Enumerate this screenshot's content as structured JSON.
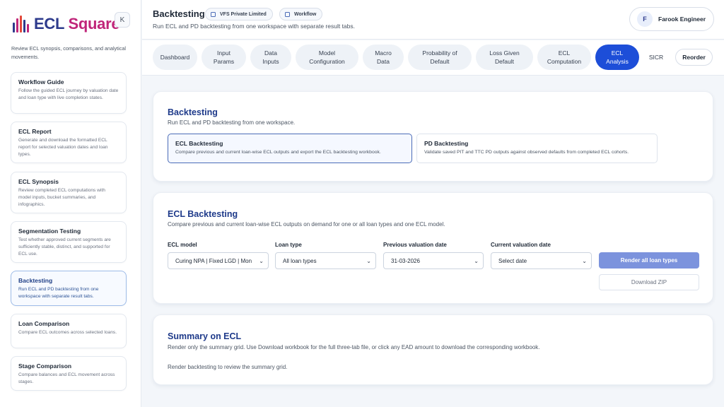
{
  "app": {
    "logo_ecl": "ECL",
    "logo_square": "Square",
    "collapse_label": "K",
    "description": "Review ECL synopsis, comparisons, and analytical movements."
  },
  "sidebar": {
    "items": [
      {
        "title": "Workflow Guide",
        "desc": "Follow the guided ECL journey by valuation date and loan type with live completion states."
      },
      {
        "title": "ECL Report",
        "desc": "Generate and download the formatted ECL report for selected valuation dates and loan types."
      },
      {
        "title": "ECL Synopsis",
        "desc": "Review completed ECL computations with model inputs, bucket summaries, and infographics."
      },
      {
        "title": "Segmentation Testing",
        "desc": "Test whether approved current segments are sufficiently stable, distinct, and supported for ECL use."
      },
      {
        "title": "Backtesting",
        "desc": "Run ECL and PD backtesting from one workspace with separate result tabs."
      },
      {
        "title": "Loan Comparison",
        "desc": "Compare ECL outcomes across selected loans."
      },
      {
        "title": "Stage Comparison",
        "desc": "Compare balances and ECL movement across stages."
      }
    ]
  },
  "header": {
    "title": "Backtesting",
    "chip_company": "VFS Private Limited",
    "chip_workflow": "Workflow",
    "subtitle": "Run ECL and PD backtesting from one workspace with separate result tabs.",
    "user_initial": "F",
    "user_name": "Farook Engineer"
  },
  "tabs": [
    {
      "label": "Dashboard"
    },
    {
      "label": "Input\nParams"
    },
    {
      "label": "Data\nInputs"
    },
    {
      "label": "Model\nConfiguration"
    },
    {
      "label": "Macro\nData"
    },
    {
      "label": "Probability of\nDefault"
    },
    {
      "label": "Loss Given\nDefault"
    },
    {
      "label": "ECL\nComputation"
    },
    {
      "label": "ECL\nAnalysis"
    },
    {
      "label": "SICR"
    }
  ],
  "reorder_label": "Reorder",
  "backtesting_panel": {
    "title": "Backtesting",
    "subtitle": "Run ECL and PD backtesting from one workspace.",
    "options": [
      {
        "title": "ECL Backtesting",
        "desc": "Compare previous and current loan-wise ECL outputs and export the ECL backtesting workbook."
      },
      {
        "title": "PD Backtesting",
        "desc": "Validate saved PIT and TTC PD outputs against observed defaults from completed ECL cohorts."
      }
    ]
  },
  "ecl_panel": {
    "title": "ECL Backtesting",
    "subtitle": "Compare previous and current loan-wise ECL outputs on demand for one or all loan types and one ECL model.",
    "fields": [
      {
        "label": "ECL model",
        "value": "Curing NPA | Fixed LGD | Mon"
      },
      {
        "label": "Loan type",
        "value": "All loan types"
      },
      {
        "label": "Previous valuation date",
        "value": "31-03-2026"
      },
      {
        "label": "Current valuation date",
        "value": "Select date"
      }
    ],
    "render_button": "Render all loan types",
    "download_button": "Download ZIP"
  },
  "summary_panel": {
    "title": "Summary on ECL",
    "subtitle": "Render only the summary grid. Use Download workbook for the full three-tab file, or click any EAD amount to download the corresponding workbook.",
    "empty_text": "Render backtesting to review the summary grid."
  },
  "colors": {
    "accent": "#1d4ed8",
    "title_blue": "#1e3a8a",
    "logo_magenta": "#c0267a",
    "button_blue": "#7c93dd"
  }
}
